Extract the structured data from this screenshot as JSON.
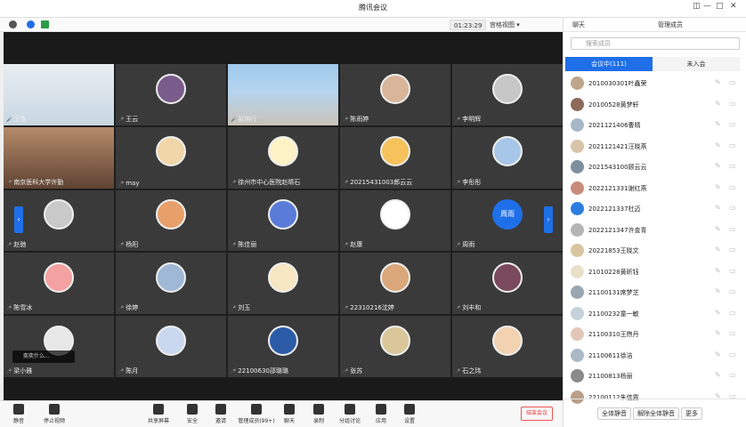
{
  "window": {
    "title": "腾讯会议"
  },
  "toolbar": {
    "timer": "01:23:29",
    "view_label": "宫格视图"
  },
  "grid": {
    "tiles": [
      {
        "name": "王浩"
      },
      {
        "name": "王云"
      },
      {
        "name": "彭旭行"
      },
      {
        "name": "陈雨婷"
      },
      {
        "name": "李明辉"
      },
      {
        "name": "南京医科大学许勤"
      },
      {
        "name": "may"
      },
      {
        "name": "徐州市中心医院赵晴石"
      },
      {
        "name": "20215431003郎云云"
      },
      {
        "name": "李彤彤"
      },
      {
        "name": "赵驰"
      },
      {
        "name": "杨阳"
      },
      {
        "name": "陈佳丽"
      },
      {
        "name": "赵康"
      },
      {
        "name": "周雨"
      },
      {
        "name": "陈雪冰"
      },
      {
        "name": "徐婷"
      },
      {
        "name": "刘玉"
      },
      {
        "name": "22310216沈婷"
      },
      {
        "name": "刘丰和"
      },
      {
        "name": "梁小雅"
      },
      {
        "name": "陈月"
      },
      {
        "name": "22100630邵璐璐"
      },
      {
        "name": "张苏"
      },
      {
        "name": "石之玮"
      }
    ],
    "initials_tile": "周雨",
    "chip": "奕奕什么..."
  },
  "bottom": {
    "buttons": [
      "静音",
      "停止视频",
      "共享屏幕",
      "安全",
      "邀请",
      "管理成员(99+)",
      "聊天",
      "录制",
      "分组讨论",
      "应用",
      "设置"
    ],
    "leave": "结束会议"
  },
  "panel": {
    "tab_chat": "聊天",
    "tab_members": "管理成员",
    "search_placeholder": "搜索成员",
    "sub_in_meeting": "会议中(111)",
    "sub_not_joined": "未入会",
    "members": [
      "2010030301叶鑫荣",
      "20100528黄梦轩",
      "2021121406曹晴",
      "2021121421汪晓燕",
      "2021543100顾云云",
      "2022121331谢红燕",
      "2022121337杜迈",
      "2022121347许金青",
      "20221853王晓文",
      "21010228黄昕钰",
      "21100131席梦芝",
      "21100232童一敏",
      "21100310王煦丹",
      "21100611徐洁",
      "21100813杨丽",
      "22100112朱佳雯"
    ],
    "btn_mute_all": "全体静音",
    "btn_unmute_all": "解除全体静音",
    "btn_more": "更多"
  },
  "colors": {
    "accent": "#1e6fe8",
    "tile_bg": "#3a3a3a",
    "leave": "#e33333"
  }
}
